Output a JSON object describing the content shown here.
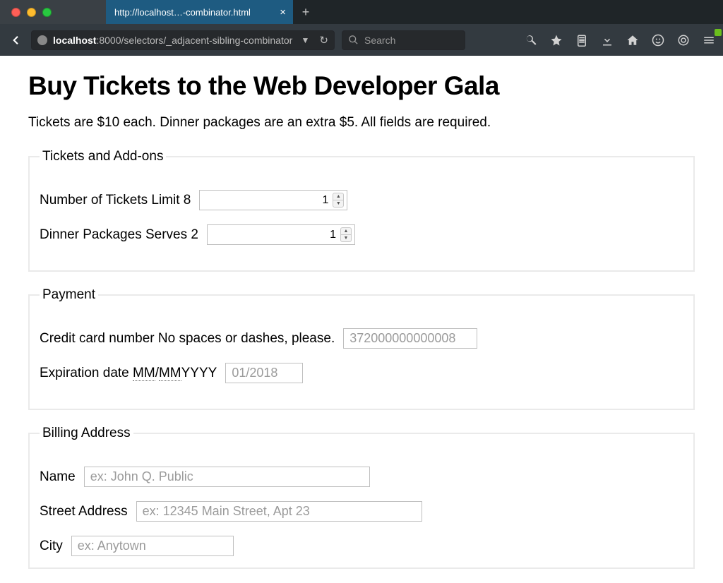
{
  "browser": {
    "tab_title": "http://localhost…-combinator.html",
    "url_host": "localhost",
    "url_rest": ":8000/selectors/_adjacent-sibling-combinator",
    "search_placeholder": "Search"
  },
  "heading": "Buy Tickets to the Web Developer Gala",
  "intro": "Tickets are $10 each. Dinner packages are an extra $5. All fields are required.",
  "fieldsets": {
    "tickets": {
      "legend": "Tickets and Add-ons",
      "num_tickets_label": "Number of Tickets",
      "num_tickets_hint": "Limit 8",
      "num_tickets_value": "1",
      "dinner_label": "Dinner Packages",
      "dinner_hint": "Serves 2",
      "dinner_value": "1"
    },
    "payment": {
      "legend": "Payment",
      "cc_label": "Credit card number",
      "cc_hint": "No spaces or dashes, please.",
      "cc_placeholder": "372000000000008",
      "exp_label": "Expiration date",
      "exp_hint1": "MM",
      "exp_hint2": "/",
      "exp_hint3": "MM",
      "exp_hint4": "YYYY",
      "exp_placeholder": "01/2018"
    },
    "billing": {
      "legend": "Billing Address",
      "name_label": "Name",
      "name_placeholder": "ex: John Q. Public",
      "street_label": "Street Address",
      "street_placeholder": "ex: 12345 Main Street, Apt 23",
      "city_label": "City",
      "city_placeholder": "ex: Anytown"
    }
  }
}
